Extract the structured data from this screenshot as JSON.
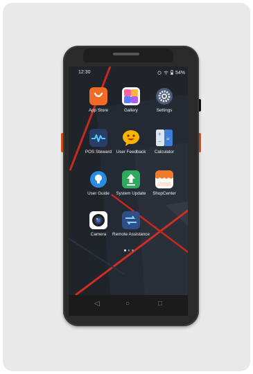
{
  "status_bar": {
    "time": "12:30",
    "battery": "54%",
    "icons": [
      "alarm-icon",
      "wifi-icon",
      "battery-icon"
    ]
  },
  "apps": [
    {
      "label": "App Store",
      "icon": "app-store-icon",
      "color": "#f26b24"
    },
    {
      "label": "Gallery",
      "icon": "gallery-icon",
      "color": "#ffffff"
    },
    {
      "label": "Settings",
      "icon": "settings-icon",
      "color": "#4a5c77"
    },
    {
      "label": "POS Steward",
      "icon": "pos-steward-icon",
      "color": "#273f66"
    },
    {
      "label": "User Feedback",
      "icon": "user-feedback-icon",
      "color": "#f6b400"
    },
    {
      "label": "Calculator",
      "icon": "calculator-icon",
      "color": "#3d7fd8"
    },
    {
      "label": "User Guide",
      "icon": "user-guide-icon",
      "color": "#2a8be2"
    },
    {
      "label": "System Update",
      "icon": "system-update-icon",
      "color": "#2ea95e"
    },
    {
      "label": "ShopCenter",
      "icon": "shop-center-icon",
      "color": "#f07a2c"
    },
    {
      "label": "Camera",
      "icon": "camera-icon",
      "color": "#ffffff"
    },
    {
      "label": "Remote Assistance",
      "icon": "remote-assistance-icon",
      "color": "#2d4f86"
    }
  ],
  "page_indicator": {
    "pages": 3,
    "current": 1
  },
  "nav_bar": {
    "back": "◁",
    "home": "○",
    "recents": "□"
  }
}
